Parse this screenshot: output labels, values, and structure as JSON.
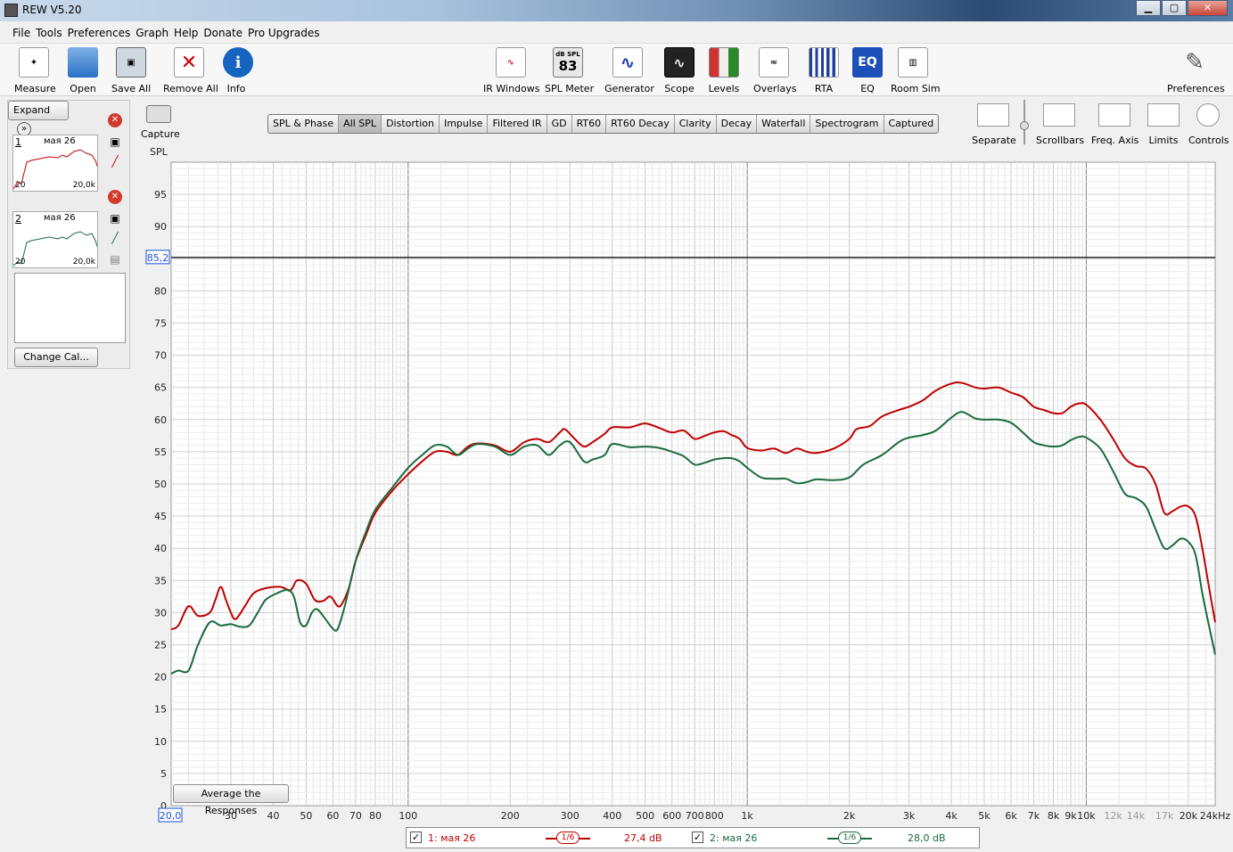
{
  "window": {
    "title": "REW V5.20",
    "minimize": "▁",
    "maximize": "▢",
    "close": "✕"
  },
  "menu": [
    "File",
    "Tools",
    "Preferences",
    "Graph",
    "Help",
    "Donate",
    "Pro Upgrades"
  ],
  "toolbar": {
    "measure": "Measure",
    "open": "Open",
    "save_all": "Save All",
    "remove_all": "Remove All",
    "info": "Info",
    "ir_windows": "IR Windows",
    "spl_meter": "SPL Meter",
    "spl_meter_unit": "dB SPL",
    "spl_meter_value": "83",
    "generator": "Generator",
    "scope": "Scope",
    "levels": "Levels",
    "overlays": "Overlays",
    "rta": "RTA",
    "eq": "EQ",
    "eq_icon_text": "EQ",
    "room_sim": "Room Sim",
    "preferences": "Preferences"
  },
  "left_panel": {
    "expand": "Expand",
    "measurements": [
      {
        "num": "1",
        "date": "мая 26",
        "fmin": "20",
        "fmax": "20,0k",
        "color": "#c00000"
      },
      {
        "num": "2",
        "date": "мая 26",
        "fmin": "20",
        "fmax": "20,0k",
        "color": "#1a6b3c"
      }
    ],
    "change_cal": "Change Cal..."
  },
  "capture": "Capture",
  "tabs": [
    {
      "label": "SPL & Phase",
      "active": false
    },
    {
      "label": "All SPL",
      "active": true
    },
    {
      "label": "Distortion",
      "active": false
    },
    {
      "label": "Impulse",
      "active": false
    },
    {
      "label": "Filtered IR",
      "active": false
    },
    {
      "label": "GD",
      "active": false
    },
    {
      "label": "RT60",
      "active": false
    },
    {
      "label": "RT60 Decay",
      "active": false
    },
    {
      "label": "Clarity",
      "active": false
    },
    {
      "label": "Decay",
      "active": false
    },
    {
      "label": "Waterfall",
      "active": false
    },
    {
      "label": "Spectrogram",
      "active": false
    },
    {
      "label": "Captured",
      "active": false
    }
  ],
  "right_tools": {
    "separate": "Separate",
    "scrollbars": "Scrollbars",
    "freq_axis": "Freq. Axis",
    "limits": "Limits",
    "controls": "Controls"
  },
  "avg_button": "Average the Responses",
  "legend": {
    "items": [
      {
        "checked": "✓",
        "name": "1: мая 26",
        "smoothing": "1/6",
        "level": "27,4 dB",
        "color": "#c00000"
      },
      {
        "checked": "✓",
        "name": "2: мая 26",
        "smoothing": "1/6",
        "level": "28,0 dB",
        "color": "#1a6b3c"
      }
    ]
  },
  "chart_data": {
    "type": "line",
    "ylabel": "SPL",
    "xscale": "log",
    "xlim": [
      20,
      24000
    ],
    "ylim": [
      0,
      100
    ],
    "cursor_y": 85.2,
    "cursor_label": "85,2",
    "x_start_label": "20,0",
    "grid": true,
    "y_ticks": [
      0,
      5,
      10,
      15,
      20,
      25,
      30,
      35,
      40,
      45,
      50,
      55,
      60,
      65,
      70,
      75,
      80,
      85,
      90,
      95
    ],
    "x_ticks": [
      {
        "v": 30,
        "l": "30",
        "gray": false
      },
      {
        "v": 40,
        "l": "40",
        "gray": false
      },
      {
        "v": 50,
        "l": "50",
        "gray": false
      },
      {
        "v": 60,
        "l": "60",
        "gray": false
      },
      {
        "v": 70,
        "l": "70",
        "gray": false
      },
      {
        "v": 80,
        "l": "80",
        "gray": false
      },
      {
        "v": 100,
        "l": "100",
        "gray": false
      },
      {
        "v": 200,
        "l": "200",
        "gray": false
      },
      {
        "v": 300,
        "l": "300",
        "gray": false
      },
      {
        "v": 400,
        "l": "400",
        "gray": false
      },
      {
        "v": 500,
        "l": "500",
        "gray": false
      },
      {
        "v": 600,
        "l": "600",
        "gray": false
      },
      {
        "v": 700,
        "l": "700",
        "gray": false
      },
      {
        "v": 800,
        "l": "800",
        "gray": false
      },
      {
        "v": 1000,
        "l": "1k",
        "gray": false
      },
      {
        "v": 2000,
        "l": "2k",
        "gray": false
      },
      {
        "v": 3000,
        "l": "3k",
        "gray": false
      },
      {
        "v": 4000,
        "l": "4k",
        "gray": false
      },
      {
        "v": 5000,
        "l": "5k",
        "gray": false
      },
      {
        "v": 6000,
        "l": "6k",
        "gray": false
      },
      {
        "v": 7000,
        "l": "7k",
        "gray": false
      },
      {
        "v": 8000,
        "l": "8k",
        "gray": false
      },
      {
        "v": 9000,
        "l": "9k",
        "gray": false
      },
      {
        "v": 10000,
        "l": "10k",
        "gray": false
      },
      {
        "v": 12000,
        "l": "12k",
        "gray": true
      },
      {
        "v": 14000,
        "l": "14k",
        "gray": true
      },
      {
        "v": 17000,
        "l": "17k",
        "gray": true
      },
      {
        "v": 20000,
        "l": "20k",
        "gray": false
      },
      {
        "v": 24000,
        "l": "24kHz",
        "gray": false
      }
    ],
    "series": [
      {
        "name": "1: мая 26",
        "color": "#c00000",
        "points": [
          [
            20,
            27.4
          ],
          [
            21,
            28
          ],
          [
            22.5,
            31
          ],
          [
            24,
            29.5
          ],
          [
            26,
            30
          ],
          [
            27,
            32
          ],
          [
            28,
            34
          ],
          [
            29,
            32
          ],
          [
            30,
            30
          ],
          [
            31,
            29
          ],
          [
            33,
            31
          ],
          [
            35,
            33
          ],
          [
            38,
            33.8
          ],
          [
            42,
            34
          ],
          [
            45,
            33.5
          ],
          [
            47,
            35
          ],
          [
            50,
            34.5
          ],
          [
            53,
            32
          ],
          [
            56,
            31.8
          ],
          [
            59,
            32.5
          ],
          [
            62,
            31
          ],
          [
            64,
            31.5
          ],
          [
            67,
            34
          ],
          [
            70,
            38
          ],
          [
            75,
            42
          ],
          [
            80,
            45.5
          ],
          [
            90,
            49
          ],
          [
            100,
            51.5
          ],
          [
            110,
            53.5
          ],
          [
            120,
            55
          ],
          [
            130,
            55
          ],
          [
            140,
            54.5
          ],
          [
            150,
            55.8
          ],
          [
            160,
            56.3
          ],
          [
            180,
            56
          ],
          [
            200,
            55
          ],
          [
            220,
            56.5
          ],
          [
            240,
            57
          ],
          [
            260,
            56.5
          ],
          [
            280,
            58
          ],
          [
            290,
            58.5
          ],
          [
            310,
            57
          ],
          [
            330,
            55.8
          ],
          [
            350,
            56.5
          ],
          [
            380,
            57.8
          ],
          [
            400,
            58.8
          ],
          [
            450,
            58.8
          ],
          [
            500,
            59.4
          ],
          [
            550,
            58.7
          ],
          [
            600,
            58
          ],
          [
            650,
            58.3
          ],
          [
            700,
            57
          ],
          [
            750,
            57.5
          ],
          [
            800,
            58
          ],
          [
            850,
            58.2
          ],
          [
            900,
            57.6
          ],
          [
            950,
            57
          ],
          [
            1000,
            55.6
          ],
          [
            1100,
            55.2
          ],
          [
            1200,
            55.5
          ],
          [
            1300,
            54.8
          ],
          [
            1400,
            55.5
          ],
          [
            1500,
            55
          ],
          [
            1600,
            54.8
          ],
          [
            1800,
            55.5
          ],
          [
            2000,
            57
          ],
          [
            2100,
            58.5
          ],
          [
            2300,
            59
          ],
          [
            2500,
            60.5
          ],
          [
            2800,
            61.5
          ],
          [
            3000,
            62
          ],
          [
            3300,
            63
          ],
          [
            3600,
            64.5
          ],
          [
            4000,
            65.6
          ],
          [
            4300,
            65.7
          ],
          [
            4700,
            65
          ],
          [
            5000,
            64.8
          ],
          [
            5500,
            65
          ],
          [
            6000,
            64.2
          ],
          [
            6500,
            63.5
          ],
          [
            7000,
            62
          ],
          [
            7500,
            61.5
          ],
          [
            8000,
            61
          ],
          [
            8500,
            61
          ],
          [
            9000,
            62
          ],
          [
            9500,
            62.5
          ],
          [
            10000,
            62.3
          ],
          [
            11000,
            60
          ],
          [
            12000,
            57
          ],
          [
            13000,
            54
          ],
          [
            14000,
            52.8
          ],
          [
            15000,
            52.4
          ],
          [
            16000,
            50
          ],
          [
            17000,
            45.5
          ],
          [
            18000,
            45.8
          ],
          [
            19000,
            46.5
          ],
          [
            20000,
            46.5
          ],
          [
            21000,
            45
          ],
          [
            22000,
            40
          ],
          [
            23000,
            34
          ],
          [
            24000,
            28.5
          ]
        ]
      },
      {
        "name": "2: мая 26",
        "color": "#1a6b3c",
        "points": [
          [
            20,
            20.5
          ],
          [
            21,
            21
          ],
          [
            22.5,
            21
          ],
          [
            24,
            25
          ],
          [
            26,
            28.5
          ],
          [
            28,
            28
          ],
          [
            30,
            28.2
          ],
          [
            32,
            27.8
          ],
          [
            34,
            28
          ],
          [
            36,
            30
          ],
          [
            38,
            32
          ],
          [
            41,
            33
          ],
          [
            44,
            33.5
          ],
          [
            46,
            32.5
          ],
          [
            48,
            28.5
          ],
          [
            50,
            28
          ],
          [
            52,
            30
          ],
          [
            54,
            30.5
          ],
          [
            57,
            29
          ],
          [
            60,
            27.5
          ],
          [
            62,
            27.5
          ],
          [
            65,
            31
          ],
          [
            70,
            38
          ],
          [
            75,
            42.5
          ],
          [
            80,
            46
          ],
          [
            90,
            49.5
          ],
          [
            100,
            52.5
          ],
          [
            110,
            54.5
          ],
          [
            120,
            56
          ],
          [
            130,
            55.8
          ],
          [
            140,
            54.5
          ],
          [
            150,
            55.5
          ],
          [
            160,
            56.2
          ],
          [
            180,
            55.8
          ],
          [
            200,
            54.5
          ],
          [
            220,
            55.8
          ],
          [
            240,
            56
          ],
          [
            260,
            54.5
          ],
          [
            280,
            56
          ],
          [
            300,
            56.5
          ],
          [
            330,
            53.5
          ],
          [
            350,
            53.8
          ],
          [
            380,
            54.5
          ],
          [
            400,
            56.2
          ],
          [
            450,
            55.7
          ],
          [
            500,
            55.8
          ],
          [
            550,
            55.6
          ],
          [
            600,
            55
          ],
          [
            650,
            54.3
          ],
          [
            700,
            53
          ],
          [
            750,
            53.3
          ],
          [
            800,
            53.8
          ],
          [
            850,
            54
          ],
          [
            900,
            54
          ],
          [
            950,
            53.5
          ],
          [
            1000,
            52.5
          ],
          [
            1100,
            51
          ],
          [
            1200,
            50.8
          ],
          [
            1300,
            50.8
          ],
          [
            1400,
            50.1
          ],
          [
            1500,
            50.3
          ],
          [
            1600,
            50.7
          ],
          [
            1800,
            50.6
          ],
          [
            2000,
            51
          ],
          [
            2200,
            53
          ],
          [
            2500,
            54.5
          ],
          [
            2800,
            56.5
          ],
          [
            3000,
            57.2
          ],
          [
            3300,
            57.6
          ],
          [
            3600,
            58.3
          ],
          [
            4000,
            60.3
          ],
          [
            4300,
            61.2
          ],
          [
            4700,
            60.2
          ],
          [
            5000,
            60
          ],
          [
            5500,
            60
          ],
          [
            6000,
            59.5
          ],
          [
            6500,
            58
          ],
          [
            7000,
            56.5
          ],
          [
            7500,
            56
          ],
          [
            8000,
            55.8
          ],
          [
            8500,
            56
          ],
          [
            9000,
            56.8
          ],
          [
            9500,
            57.3
          ],
          [
            10000,
            57.2
          ],
          [
            11000,
            55.5
          ],
          [
            12000,
            52
          ],
          [
            13000,
            48.5
          ],
          [
            14000,
            47.8
          ],
          [
            15000,
            46.5
          ],
          [
            16000,
            43
          ],
          [
            17000,
            40
          ],
          [
            18000,
            40.5
          ],
          [
            19000,
            41.5
          ],
          [
            20000,
            41
          ],
          [
            21000,
            39
          ],
          [
            22000,
            33
          ],
          [
            23000,
            28
          ],
          [
            24000,
            23.5
          ]
        ]
      }
    ]
  }
}
